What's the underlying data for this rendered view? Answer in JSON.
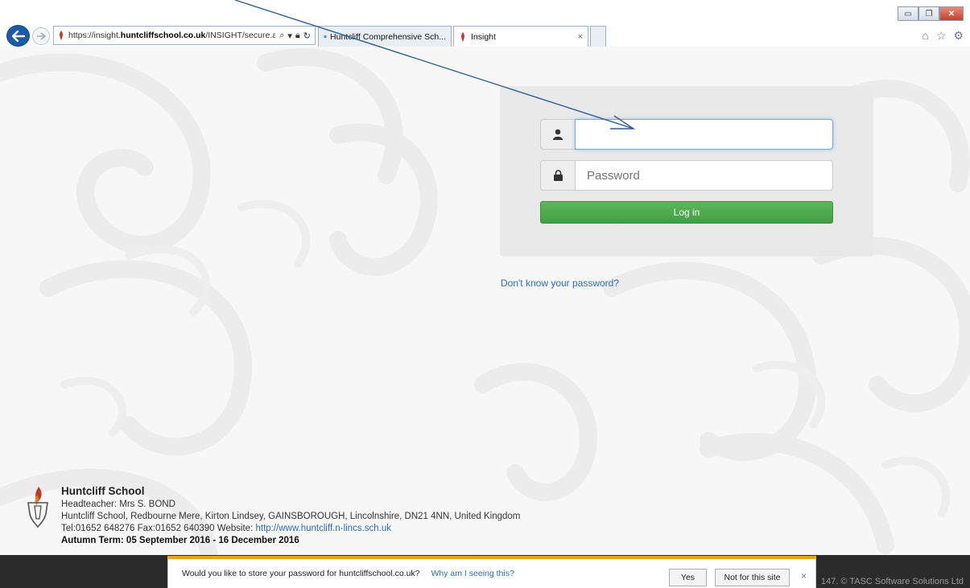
{
  "browser": {
    "address_url_plain": "https://insight.",
    "address_url_bold": "huntcliffschool.co.uk",
    "address_url_rest": "/INSIGHT/secure.as",
    "tabs": [
      {
        "label": "Huntcliff Comprehensive Sch..."
      },
      {
        "label": "Insight",
        "close": "×"
      }
    ]
  },
  "login": {
    "username_value": "",
    "password_placeholder": "Password",
    "login_label": "Log in",
    "forgot_label": "Don't know your password?"
  },
  "school": {
    "name": "Huntcliff School",
    "headteacher": "Headteacher: Mrs S. BOND",
    "address": "Huntcliff School, Redbourne Mere, Kirton Lindsey, GAINSBOROUGH, Lincolnshire, DN21 4NN, United Kingdom",
    "contact": "Tel:01652 648276   Fax:01652 640390   Website: ",
    "website": "http://www.huntcliff.n-lincs.sch.uk",
    "term": "Autumn Term: 05 September 2016 - 16 December 2016"
  },
  "footer": {
    "copyright": "147. © TASC Software Solutions Ltd"
  },
  "notification": {
    "message": "Would you like to store your password for huntcliffschool.co.uk?",
    "why_label": "Why am I seeing this?",
    "yes_label": "Yes",
    "not_for_site_label": "Not for this site",
    "close": "×"
  },
  "colors": {
    "accent_green": "#5cb85c",
    "link_blue": "#2a6ebb",
    "notify_orange": "#f0a30a",
    "arrow_blue": "#2c5e9e"
  }
}
